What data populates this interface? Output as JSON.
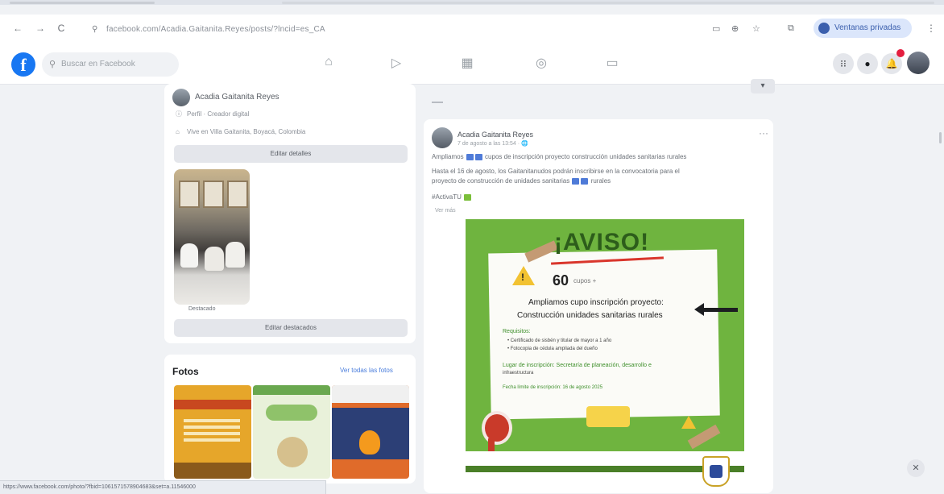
{
  "browser": {
    "url": "facebook.com/Acadia.Gaitanita.Reyes/posts/?lncid=es_CA",
    "profile_label": "Ventanas privadas",
    "back": "←",
    "forward": "→",
    "reload": "C",
    "menu": "⋮"
  },
  "fb_header": {
    "search_placeholder": "Buscar en Facebook",
    "logo": "f"
  },
  "intro": {
    "profile_name": "Acadia Gaitanita Reyes",
    "line1": "Perfil · Creador digital",
    "line2": "Vive en Villa Gaitanita, Boyacá, Colombia",
    "edit_details": "Editar detalles",
    "photo_caption": "Destacado",
    "edit_featured": "Editar destacados"
  },
  "fotos": {
    "title": "Fotos",
    "see_all": "Ver todas las fotos"
  },
  "post": {
    "author": "Acadia Gaitanita Reyes",
    "date": "7 de agosto a las 13:54 · 🌐",
    "text1": "Ampliamos",
    "text1b": "cupos de inscripción proyecto construcción unidades sanitarias rurales",
    "text2": "Hasta el 16 de agosto, los Gaitanitanudos podrán inscribirse en la convocatoria para el",
    "text3": "proyecto de construcción de unidades sanitarias",
    "text3b": "rurales",
    "text4": "#ActivaTU",
    "see_more": "Ver más",
    "more": "···"
  },
  "flyer": {
    "heading": "¡AVISO!",
    "number": "60",
    "number_sub": "cupos +",
    "line1": "Ampliamos cupo inscripción proyecto:",
    "line2": "Construcción unidades sanitarias rurales",
    "requirements": "Requisitos:",
    "req1": "• Certificado de sisbén y titular de mayor a 1 año",
    "req2": "• Fotocopia de cédula ampliada del dueño",
    "place": "Lugar de inscripción: Secretaría de planeación, desarrollo e",
    "place2": "infraestructura",
    "date_line": "Fecha límite de inscripción: 16 de agosto 2025"
  },
  "status_bar": "https://www.facebook.com/photo/?fbid=1061571578904683&set=a.11546000"
}
